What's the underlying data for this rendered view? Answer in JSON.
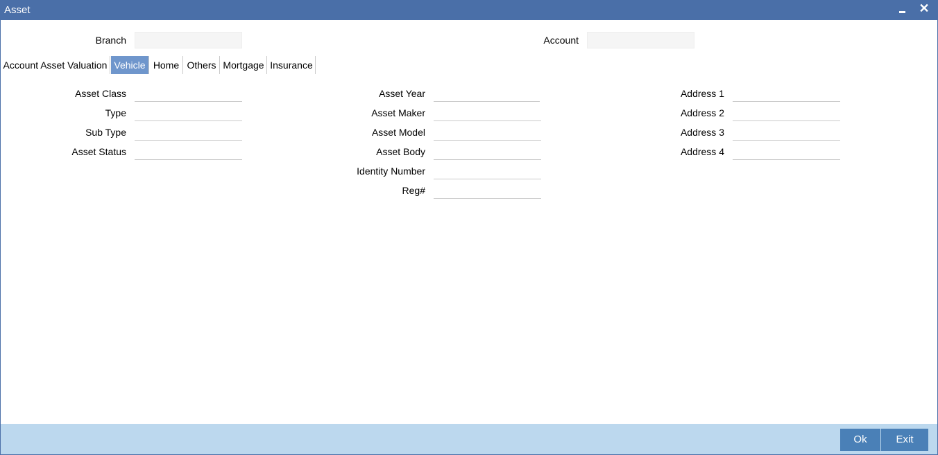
{
  "window": {
    "title": "Asset"
  },
  "header": {
    "branch_label": "Branch",
    "branch_value": "",
    "account_label": "Account",
    "account_value": ""
  },
  "tabs": [
    {
      "label": "Account Asset Valuation",
      "active": false
    },
    {
      "label": "Vehicle",
      "active": true
    },
    {
      "label": "Home",
      "active": false
    },
    {
      "label": "Others",
      "active": false
    },
    {
      "label": "Mortgage",
      "active": false
    },
    {
      "label": "Insurance",
      "active": false
    }
  ],
  "vehicle": {
    "col1": [
      {
        "label": "Asset Class",
        "value": ""
      },
      {
        "label": "Type",
        "value": ""
      },
      {
        "label": "Sub Type",
        "value": ""
      },
      {
        "label": "Asset Status",
        "value": ""
      }
    ],
    "col2": [
      {
        "label": "Asset Year",
        "value": ""
      },
      {
        "label": "Asset Maker",
        "value": ""
      },
      {
        "label": "Asset Model",
        "value": ""
      },
      {
        "label": "Asset Body",
        "value": ""
      },
      {
        "label": "Identity Number",
        "value": ""
      },
      {
        "label": "Reg#",
        "value": ""
      }
    ],
    "col3": [
      {
        "label": "Address 1",
        "value": ""
      },
      {
        "label": "Address 2",
        "value": ""
      },
      {
        "label": "Address 3",
        "value": ""
      },
      {
        "label": "Address 4",
        "value": ""
      }
    ]
  },
  "footer": {
    "ok_label": "Ok",
    "exit_label": "Exit"
  },
  "colors": {
    "titlebar": "#4a6fa8",
    "active_tab": "#6f96cc",
    "footer": "#bcd8ee",
    "button": "#4a80b7"
  }
}
